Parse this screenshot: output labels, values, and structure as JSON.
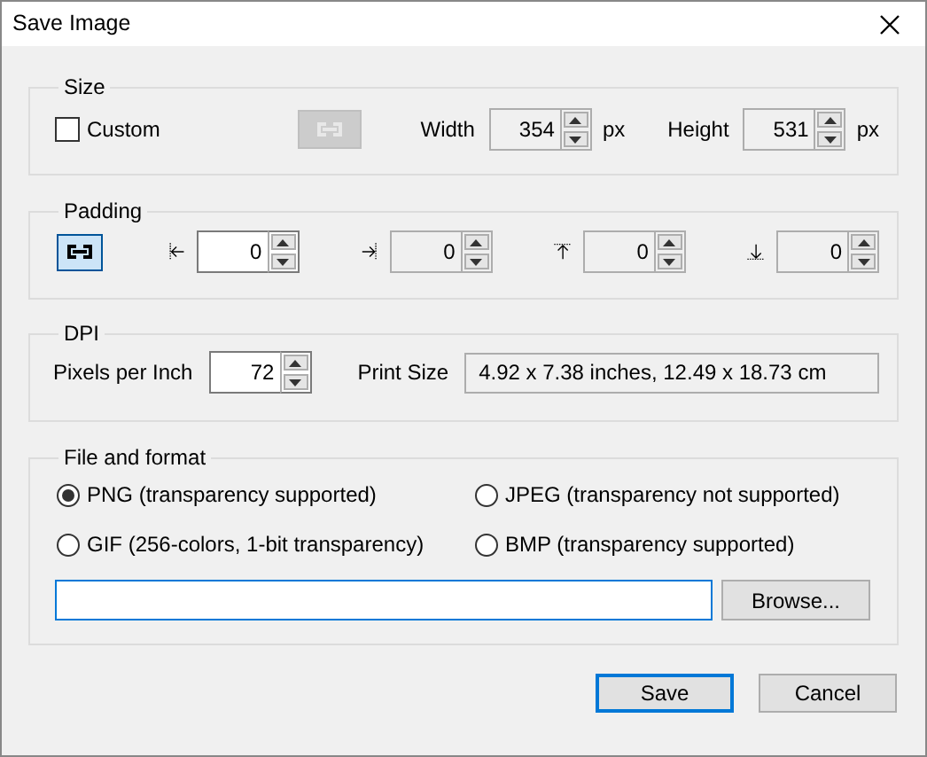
{
  "window": {
    "title": "Save Image"
  },
  "size": {
    "legend": "Size",
    "custom": {
      "label": "Custom",
      "checked": false
    },
    "link": {
      "pressed": false,
      "disabled": true
    },
    "fields": [
      {
        "label": "Width",
        "value": "354",
        "unit": "px",
        "disabled": true
      },
      {
        "label": "Height",
        "value": "531",
        "unit": "px",
        "disabled": true
      }
    ]
  },
  "padding": {
    "legend": "Padding",
    "link": {
      "pressed": true,
      "disabled": false
    },
    "fields": [
      {
        "kind": "left",
        "value": "0",
        "disabled": false
      },
      {
        "kind": "right",
        "value": "0",
        "disabled": true
      },
      {
        "kind": "top",
        "value": "0",
        "disabled": true
      },
      {
        "kind": "bottom",
        "value": "0",
        "disabled": true
      }
    ]
  },
  "dpi": {
    "legend": "DPI",
    "ppi": {
      "label": "Pixels per Inch",
      "value": "72"
    },
    "print_size": {
      "label": "Print Size",
      "value": "4.92 x 7.38 inches, 12.49 x 18.73 cm"
    }
  },
  "file": {
    "legend": "File and format",
    "formats": [
      {
        "label": "PNG (transparency supported)",
        "selected": true
      },
      {
        "label": "JPEG (transparency not supported)",
        "selected": false
      },
      {
        "label": "GIF (256-colors, 1-bit transparency)",
        "selected": false
      },
      {
        "label": "BMP (transparency supported)",
        "selected": false
      }
    ],
    "browse": "Browse..."
  },
  "buttons": [
    {
      "label": "Save",
      "default": true
    },
    {
      "label": "Cancel",
      "default": false
    }
  ]
}
